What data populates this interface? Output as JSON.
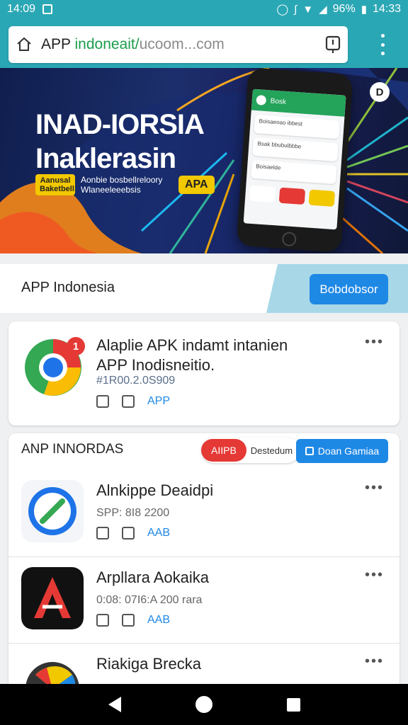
{
  "status_bar": {
    "time": "14:09",
    "battery": "96%",
    "clock_right": "14:33"
  },
  "browser": {
    "url_dark": "APP ",
    "url_green": "indoneait/",
    "url_grey": "ucoom...com"
  },
  "banner": {
    "title_line1": "INAD-IORSIA",
    "title_line2": "Inaklerasin",
    "pill_left": "Aanusal Baketbell",
    "sub_text": "Aonbie bosbellreloory Wlaneeleeebsis",
    "pill_right": "APA",
    "phone_title": "Bosk",
    "phone_card1": "Boisaeoao ibbest",
    "phone_card2": "Bsak bbubulbbbe",
    "phone_card3": "Boisaelde"
  },
  "app_header": {
    "title": "APP Indonesia",
    "button": "Bobdobsor"
  },
  "featured": {
    "badge": "1",
    "title": "Alaplie APK indamt intanien APP Inodisneitio.",
    "meta": "#1R00.2.0S909",
    "tag": "APP"
  },
  "list": {
    "header": "ANP INNORDAS",
    "seg_label": "AIIPB",
    "seg_text": "Destedum",
    "download_label": "Doan Gamiaa",
    "items": [
      {
        "title": "Alnkippe Deaidpi",
        "meta": "SPP:  8I8 2200",
        "tag": "AAB"
      },
      {
        "title": "Arpllara Aokaika",
        "meta": "0:08:  07I6:A 200 rara",
        "tag": "AAB"
      },
      {
        "title": "Riakiga Brecka",
        "meta": "",
        "tag": ""
      }
    ]
  },
  "colors": {
    "teal": "#2aa7b4",
    "accent": "#1e88e5",
    "red": "#e53935",
    "yellow": "#f2c800"
  }
}
